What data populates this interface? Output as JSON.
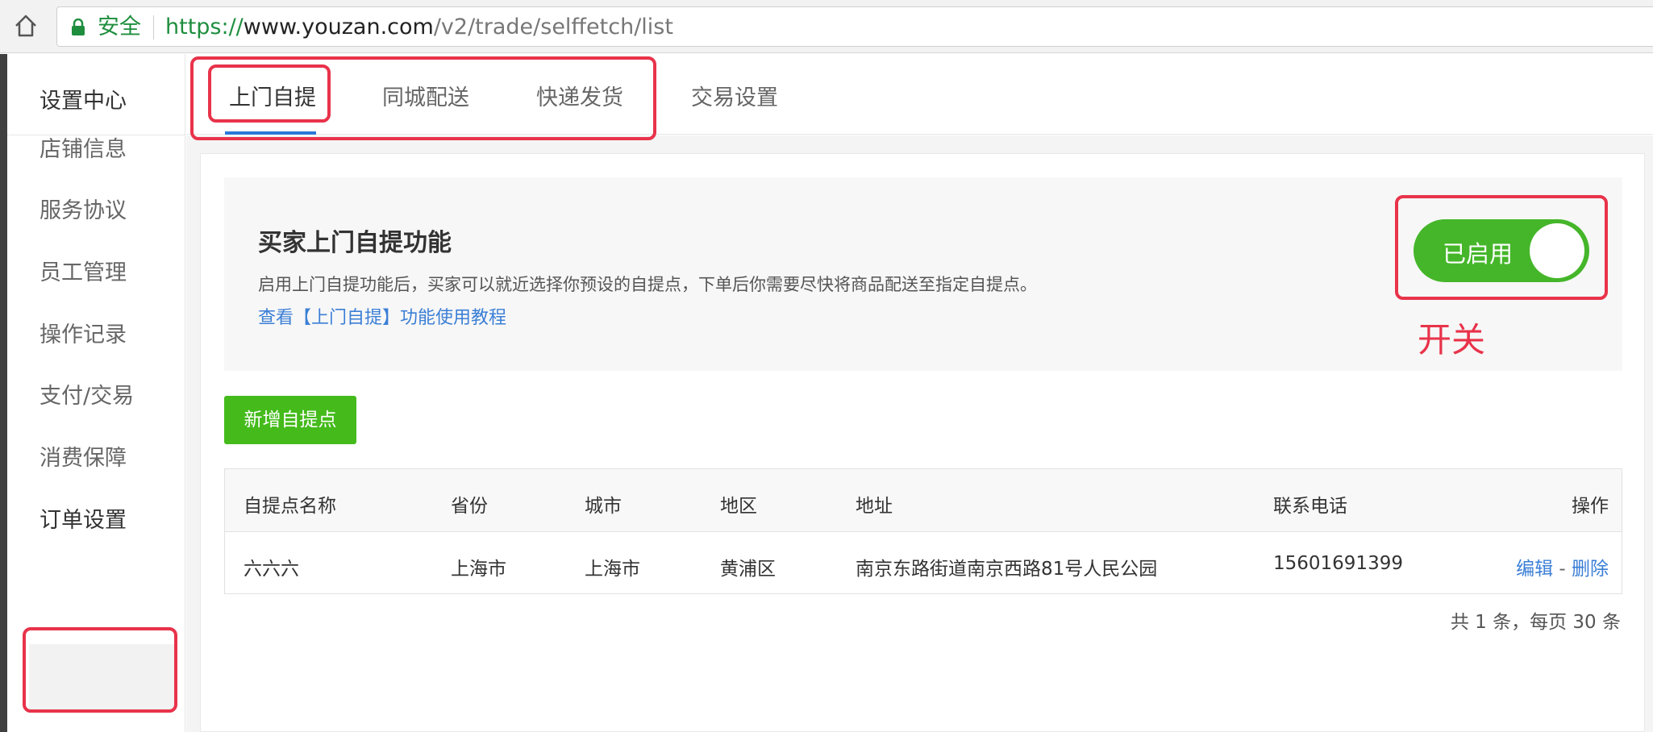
{
  "browser": {
    "secure_label": "安全",
    "url_scheme": "https://",
    "url_host": "www.youzan.com",
    "url_path": "/v2/trade/selffetch/list"
  },
  "sidebar": {
    "title": "设置中心",
    "items": [
      {
        "label": "店铺信息"
      },
      {
        "label": "服务协议"
      },
      {
        "label": "员工管理"
      },
      {
        "label": "操作记录"
      },
      {
        "label": "支付/交易"
      },
      {
        "label": "消费保障"
      },
      {
        "label": "订单设置"
      }
    ]
  },
  "tabs": [
    {
      "label": "上门自提"
    },
    {
      "label": "同城配送"
    },
    {
      "label": "快递发货"
    },
    {
      "label": "交易设置"
    }
  ],
  "intro": {
    "title": "买家上门自提功能",
    "desc": "启用上门自提功能后，买家可以就近选择你预设的自提点，下单后你需要尽快将商品配送至指定自提点。",
    "link": "查看【上门自提】功能使用教程"
  },
  "toggle": {
    "label": "已启用",
    "enabled": true
  },
  "annotation": {
    "label": "开关",
    "color": "#e8334a"
  },
  "add_button": "新增自提点",
  "table": {
    "headers": [
      "自提点名称",
      "省份",
      "城市",
      "地区",
      "地址",
      "联系电话",
      "操作"
    ],
    "rows": [
      {
        "name": "六六六",
        "province": "上海市",
        "city": "上海市",
        "district": "黄浦区",
        "address": "南京东路街道南京西路81号人民公园",
        "phone": "15601691399",
        "edit": "编辑",
        "sep": "-",
        "delete": "删除"
      }
    ]
  },
  "pager": "共 1 条，每页 30 条",
  "colors": {
    "accent_green": "#44bb1b",
    "link_blue": "#3b7fd6",
    "tab_underline": "#2b78d8"
  }
}
